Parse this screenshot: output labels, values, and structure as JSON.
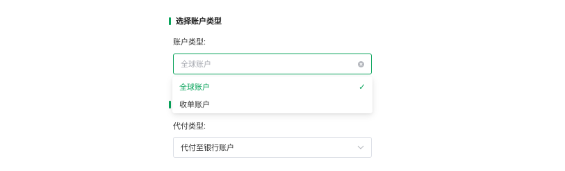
{
  "section1": {
    "title": "选择账户类型"
  },
  "account_type": {
    "label": "账户类型:",
    "placeholder": "全球账户",
    "options": [
      {
        "label": "全球账户",
        "selected": true
      },
      {
        "label": "收单账户",
        "selected": false
      }
    ]
  },
  "payment_type": {
    "label": "代付类型:",
    "value": "代付至银行账户"
  },
  "colors": {
    "accent": "#07a35a",
    "placeholder": "#a8abb2",
    "border": "#dcdfe6"
  },
  "icons": {
    "clear": "circle-x-icon",
    "check": "check-icon",
    "chevron": "chevron-down-icon"
  }
}
